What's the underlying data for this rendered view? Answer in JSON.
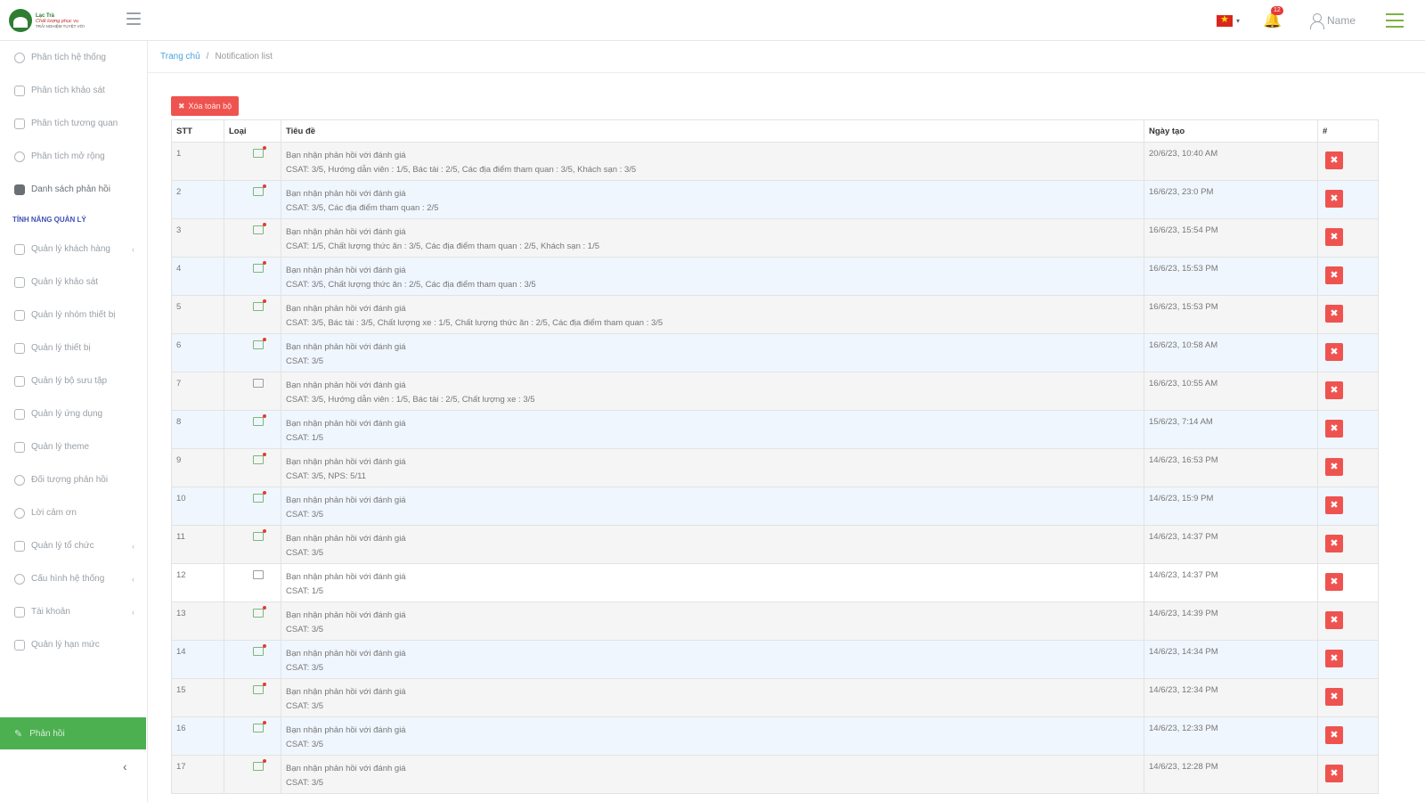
{
  "header": {
    "logo": {
      "line1": "Lạc Trà",
      "line2": "Chất lượng phục vụ",
      "line3": "TRẢI NGHIỆM TUYỆT VỜI"
    },
    "notification_count": "12",
    "username": "Name",
    "colors": {
      "accent": "#4caf50",
      "danger": "#ef5350",
      "link": "#4ba3e0"
    }
  },
  "sidebar": {
    "items": [
      {
        "label": "Phân tích hệ thống"
      },
      {
        "label": "Phân tích khảo sát"
      },
      {
        "label": "Phân tích tương quan"
      },
      {
        "label": "Phân tích mở rộng"
      },
      {
        "label": "Danh sách phản hồi"
      }
    ],
    "section_title": "TÍNH NĂNG QUẢN LÝ",
    "manage_items": [
      {
        "label": "Quản lý khách hàng"
      },
      {
        "label": "Quản lý khảo sát"
      },
      {
        "label": "Quản lý nhóm thiết bị"
      },
      {
        "label": "Quản lý thiết bị"
      },
      {
        "label": "Quản lý bộ sưu tập"
      },
      {
        "label": "Quản lý ứng dụng"
      },
      {
        "label": "Quản lý theme"
      },
      {
        "label": "Đối tượng phản hồi"
      },
      {
        "label": "Lời cảm ơn"
      },
      {
        "label": "Quản lý tổ chức"
      },
      {
        "label": "Cấu hình hệ thống"
      },
      {
        "label": "Tài khoản"
      },
      {
        "label": "Quản lý hạn mức"
      }
    ],
    "bottom_button": "Phản hồi"
  },
  "breadcrumb": {
    "home": "Trang chủ",
    "separator": "/",
    "current": "Notification list"
  },
  "toolbar": {
    "delete_all": "Xóa toàn bộ"
  },
  "table": {
    "headers": {
      "stt": "STT",
      "type": "Loại",
      "title": "Tiêu đề",
      "date": "Ngày tạo",
      "action": "#"
    },
    "rows": [
      {
        "stt": "1",
        "title": "Bạn nhận phản hồi với đánh giá",
        "detail": "CSAT: 3/5, Hướng dẫn viên : 1/5, Bác tài : 2/5, Các địa điểm tham quan : 3/5, Khách sạn : 3/5",
        "date": "20/6/23, 10:40 AM"
      },
      {
        "stt": "2",
        "title": "Bạn nhận phản hồi với đánh giá",
        "detail": "CSAT: 3/5, Các địa điểm tham quan : 2/5",
        "date": "16/6/23, 23:0 PM"
      },
      {
        "stt": "3",
        "title": "Bạn nhận phản hồi với đánh giá",
        "detail": "CSAT: 1/5, Chất lượng thức ăn : 3/5, Các địa điểm tham quan : 2/5, Khách sạn : 1/5",
        "date": "16/6/23, 15:54 PM"
      },
      {
        "stt": "4",
        "title": "Bạn nhận phản hồi với đánh giá",
        "detail": "CSAT: 3/5, Chất lượng thức ăn : 2/5, Các địa điểm tham quan : 3/5",
        "date": "16/6/23, 15:53 PM"
      },
      {
        "stt": "5",
        "title": "Bạn nhận phản hồi với đánh giá",
        "detail": "CSAT: 3/5, Bác tài : 3/5, Chất lượng xe : 1/5, Chất lượng thức ăn : 2/5, Các địa điểm tham quan : 3/5",
        "date": "16/6/23, 15:53 PM"
      },
      {
        "stt": "6",
        "title": "Bạn nhận phản hồi với đánh giá",
        "detail": "CSAT: 3/5",
        "date": "16/6/23, 10:58 AM"
      },
      {
        "stt": "7",
        "title": "Bạn nhận phản hồi với đánh giá",
        "detail": "CSAT: 3/5, Hướng dẫn viên : 1/5, Bác tài : 2/5, Chất lượng xe : 3/5",
        "date": "16/6/23, 10:55 AM"
      },
      {
        "stt": "8",
        "title": "Bạn nhận phản hồi với đánh giá",
        "detail": "CSAT: 1/5",
        "date": "15/6/23, 7:14 AM"
      },
      {
        "stt": "9",
        "title": "Bạn nhận phản hồi với đánh giá",
        "detail": "CSAT: 3/5, NPS: 5/11",
        "date": "14/6/23, 16:53 PM"
      },
      {
        "stt": "10",
        "title": "Bạn nhận phản hồi với đánh giá",
        "detail": "CSAT: 3/5",
        "date": "14/6/23, 15:9 PM"
      },
      {
        "stt": "11",
        "title": "Bạn nhận phản hồi với đánh giá",
        "detail": "CSAT: 3/5",
        "date": "14/6/23, 14:37 PM"
      },
      {
        "stt": "12",
        "title": "Bạn nhận phản hồi với đánh giá",
        "detail": "CSAT: 1/5",
        "date": "14/6/23, 14:37 PM"
      },
      {
        "stt": "13",
        "title": "Bạn nhận phản hồi với đánh giá",
        "detail": "CSAT: 3/5",
        "date": "14/6/23, 14:39 PM"
      },
      {
        "stt": "14",
        "title": "Bạn nhận phản hồi với đánh giá",
        "detail": "CSAT: 3/5",
        "date": "14/6/23, 14:34 PM"
      },
      {
        "stt": "15",
        "title": "Bạn nhận phản hồi với đánh giá",
        "detail": "CSAT: 3/5",
        "date": "14/6/23, 12:34 PM"
      },
      {
        "stt": "16",
        "title": "Bạn nhận phản hồi với đánh giá",
        "detail": "CSAT: 3/5",
        "date": "14/6/23, 12:33 PM"
      },
      {
        "stt": "17",
        "title": "Bạn nhận phản hồi với đánh giá",
        "detail": "CSAT: 3/5",
        "date": "14/6/23, 12:28 PM"
      }
    ]
  }
}
